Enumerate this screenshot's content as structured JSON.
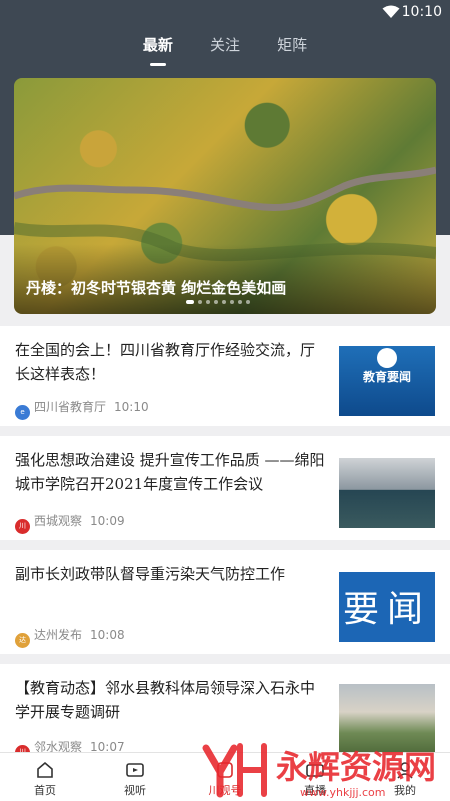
{
  "status_bar": {
    "time": "10:10"
  },
  "tabs": [
    {
      "label": "最新",
      "active": true
    },
    {
      "label": "关注",
      "active": false
    },
    {
      "label": "矩阵",
      "active": false
    }
  ],
  "banner": {
    "caption": "丹棱：初冬时节银杏黄  绚烂金色美如画",
    "page_count": 8,
    "active_index": 0
  },
  "articles": [
    {
      "title": "在全国的会上！四川省教育厅作经验交流，厅长这样表态！",
      "source": "四川省教育厅",
      "time": "10:10",
      "thumb_text": "教育要闻",
      "source_icon_color": "#3a7bd5"
    },
    {
      "title": "强化思想政治建设  提升宣传工作品质  ——绵阳城市学院召开2021年度宣传工作会议",
      "source": "西城观察",
      "time": "10:09",
      "thumb_text": "",
      "source_icon_color": "#d92c2c"
    },
    {
      "title": "副市长刘政带队督导重污染天气防控工作",
      "source": "达州发布",
      "time": "10:08",
      "thumb_text": "要闻",
      "source_icon_color": "#e0a13a"
    },
    {
      "title": "【教育动态】邻水县教科体局领导深入石永中学开展专题调研",
      "source": "邻水观察",
      "time": "10:07",
      "thumb_text": "",
      "source_icon_color": "#d92c2c"
    }
  ],
  "bottom_nav": [
    {
      "label": "首页",
      "icon": "home-icon",
      "active": false
    },
    {
      "label": "视听",
      "icon": "video-icon",
      "active": false
    },
    {
      "label": "川观号",
      "icon": "chuanguan-icon",
      "active": true
    },
    {
      "label": "直播",
      "icon": "live-icon",
      "active": false
    },
    {
      "label": "我的",
      "icon": "profile-icon",
      "active": false
    }
  ],
  "watermark": {
    "text": "永辉资源网",
    "url": "www.yhkjjj.com"
  },
  "colors": {
    "header": "#3e4853",
    "accent": "#d92c2c",
    "background": "#efeff1"
  }
}
